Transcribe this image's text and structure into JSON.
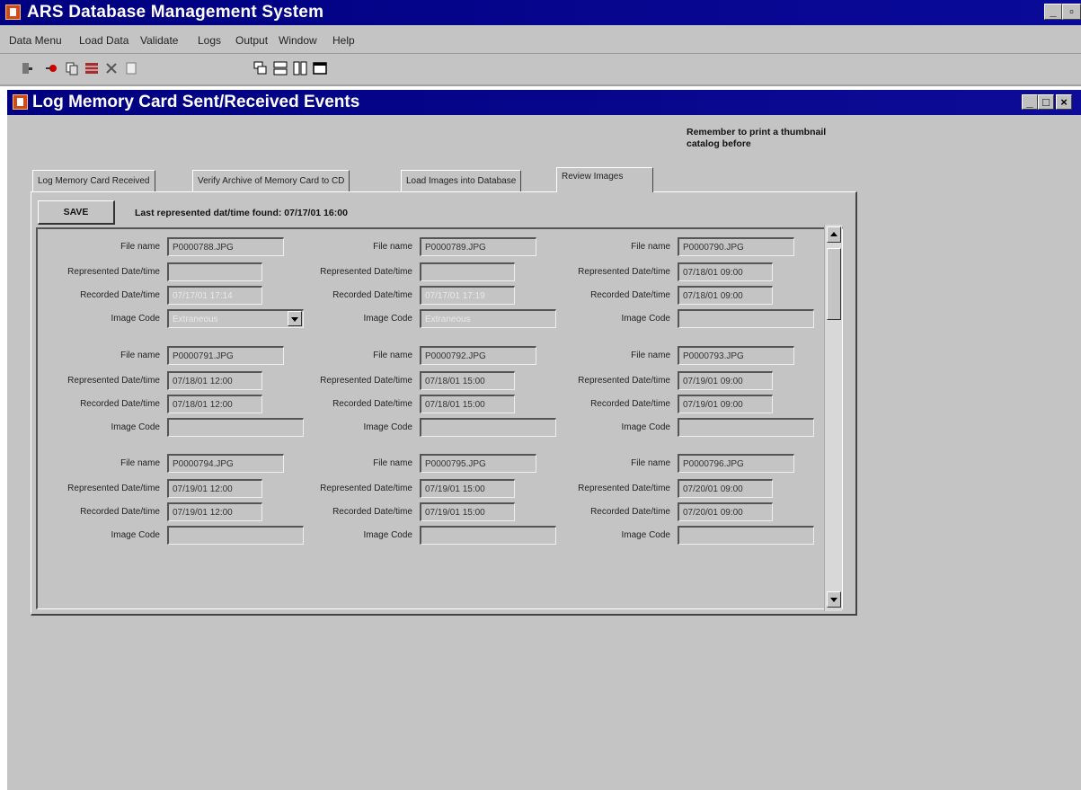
{
  "app": {
    "title": "ARS Database Management System",
    "menu": [
      "Data Menu",
      "Load Data",
      "Validate",
      "Logs",
      "Output",
      "Window",
      "Help"
    ]
  },
  "toolbar": {
    "icons": [
      "exit-icon",
      "connect-icon",
      "copy-icon",
      "grid-icon",
      "delete-icon",
      "document-icon",
      "cascade-icon",
      "tile-horizontal-icon",
      "tile-vertical-icon",
      "window-icon"
    ]
  },
  "child_window": {
    "title": "Log Memory Card Sent/Received Events"
  },
  "reminder": "Remember to print a thumbnail catalog before",
  "tabs": [
    "Log Memory Card Received",
    "Verify Archive of Memory Card to CD",
    "Load Images into Database",
    "Review Images"
  ],
  "active_tab": "Review Images",
  "save_label": "SAVE",
  "last_found": "Last represented dat/time found: 07/17/01  16:00",
  "field_labels": {
    "file_name": "File name",
    "represented": "Represented Date/time",
    "recorded": "Recorded Date/time",
    "image_code": "Image Code"
  },
  "records": [
    {
      "file": "P0000788.JPG",
      "represented": "",
      "recorded": "07/17/01  17:14",
      "image_code": "Extraneous"
    },
    {
      "file": "P0000789.JPG",
      "represented": "",
      "recorded": "07/17/01  17:19",
      "image_code": "Extraneous"
    },
    {
      "file": "P0000790.JPG",
      "represented": "07/18/01  09:00",
      "recorded": "07/18/01  09:00",
      "image_code": ""
    },
    {
      "file": "P0000791.JPG",
      "represented": "07/18/01  12:00",
      "recorded": "07/18/01  12:00",
      "image_code": ""
    },
    {
      "file": "P0000792.JPG",
      "represented": "07/18/01  15:00",
      "recorded": "07/18/01  15:00",
      "image_code": ""
    },
    {
      "file": "P0000793.JPG",
      "represented": "07/19/01  09:00",
      "recorded": "07/19/01  09:00",
      "image_code": ""
    },
    {
      "file": "P0000794.JPG",
      "represented": "07/19/01  12:00",
      "recorded": "07/19/01  12:00",
      "image_code": ""
    },
    {
      "file": "P0000795.JPG",
      "represented": "07/19/01  15:00",
      "recorded": "07/19/01  15:00",
      "image_code": ""
    },
    {
      "file": "P0000796.JPG",
      "represented": "07/20/01  09:00",
      "recorded": "07/20/01  09:00",
      "image_code": ""
    }
  ],
  "colors": {
    "titlebar": "#000080",
    "face": "#c4c4c4"
  }
}
